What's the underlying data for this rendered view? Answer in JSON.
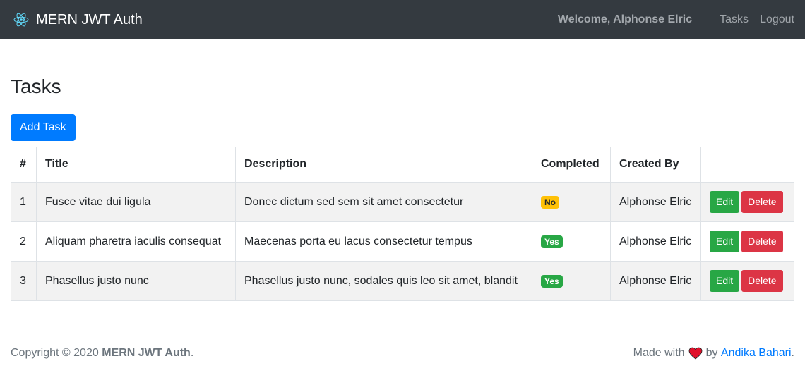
{
  "nav": {
    "brand": "MERN JWT Auth",
    "welcome": "Welcome, Alphonse Elric",
    "links": [
      "Tasks",
      "Logout"
    ]
  },
  "page": {
    "title": "Tasks",
    "add_button": "Add Task"
  },
  "table": {
    "headers": [
      "#",
      "Title",
      "Description",
      "Completed",
      "Created By",
      ""
    ],
    "rows": [
      {
        "num": "1",
        "title": "Fusce vitae dui ligula",
        "description": "Donec dictum sed sem sit amet consectetur",
        "completed": "No",
        "created_by": "Alphonse Elric"
      },
      {
        "num": "2",
        "title": "Aliquam pharetra iaculis consequat",
        "description": "Maecenas porta eu lacus consectetur tempus",
        "completed": "Yes",
        "created_by": "Alphonse Elric"
      },
      {
        "num": "3",
        "title": "Phasellus justo nunc",
        "description": "Phasellus justo nunc, sodales quis leo sit amet, blandit",
        "completed": "Yes",
        "created_by": "Alphonse Elric"
      }
    ],
    "edit_label": "Edit",
    "delete_label": "Delete"
  },
  "footer": {
    "copyright_prefix": "Copyright © 2020",
    "copyright_brand": "MERN JWT Auth",
    "copyright_suffix": ".",
    "made_with": "Made with",
    "by": "by",
    "author": "Andika Bahari",
    "author_suffix": "."
  },
  "colors": {
    "navbar": "#343a40",
    "primary": "#007bff",
    "success": "#28a745",
    "danger": "#dc3545",
    "warning": "#ffc107",
    "heart": "#e0102a"
  },
  "icons": {
    "brand": "react-icon",
    "footer": "heart-icon"
  }
}
